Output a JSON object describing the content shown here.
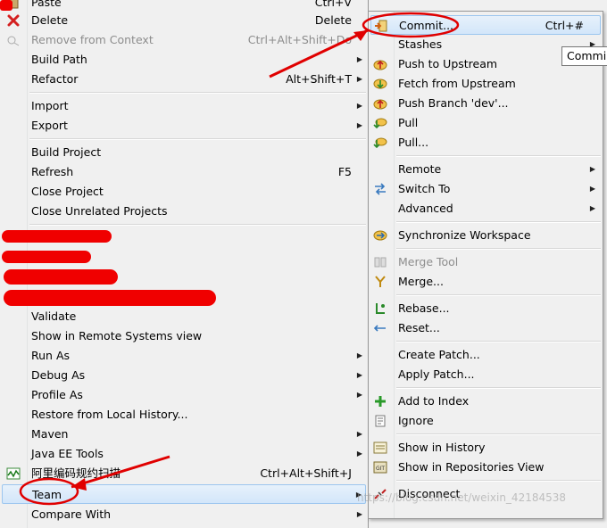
{
  "left_menu": {
    "paste": {
      "label": "Paste",
      "shortcut": "Ctrl+V"
    },
    "delete": {
      "label": "Delete",
      "shortcut": "Delete",
      "icon": "red-x-icon"
    },
    "remove_from_context": {
      "label": "Remove from Context",
      "shortcut": "Ctrl+Alt+Shift+Do"
    },
    "build_path": {
      "label": "Build Path"
    },
    "refactor": {
      "label": "Refactor",
      "shortcut": "Alt+Shift+T"
    },
    "import": {
      "label": "Import"
    },
    "export": {
      "label": "Export"
    },
    "build_project": {
      "label": "Build Project"
    },
    "refresh": {
      "label": "Refresh",
      "shortcut": "F5"
    },
    "close_project": {
      "label": "Close Project"
    },
    "close_unrelated": {
      "label": "Close Unrelated Projects"
    },
    "validate": {
      "label": "Validate"
    },
    "show_remote": {
      "label": "Show in Remote Systems view"
    },
    "run_as": {
      "label": "Run As"
    },
    "debug_as": {
      "label": "Debug As"
    },
    "profile_as": {
      "label": "Profile As"
    },
    "restore_history": {
      "label": "Restore from Local History..."
    },
    "maven": {
      "label": "Maven"
    },
    "java_ee_tools": {
      "label": "Java EE Tools"
    },
    "alibaba": {
      "label": "阿里编码规约扫描",
      "shortcut": "Ctrl+Alt+Shift+J"
    },
    "team": {
      "label": "Team"
    },
    "compare_with": {
      "label": "Compare With"
    }
  },
  "right_menu": {
    "commit": {
      "label": "Commit...",
      "shortcut": "Ctrl+#"
    },
    "stashes": {
      "label": "Stashes"
    },
    "push_upstream": {
      "label": "Push to Upstream"
    },
    "fetch_upstream": {
      "label": "Fetch from Upstream"
    },
    "push_branch": {
      "label": "Push Branch 'dev'..."
    },
    "pull": {
      "label": "Pull"
    },
    "pull_dialog": {
      "label": "Pull..."
    },
    "remote": {
      "label": "Remote"
    },
    "switch_to": {
      "label": "Switch To"
    },
    "advanced": {
      "label": "Advanced"
    },
    "synchronize": {
      "label": "Synchronize Workspace"
    },
    "merge_tool": {
      "label": "Merge Tool"
    },
    "merge": {
      "label": "Merge..."
    },
    "rebase": {
      "label": "Rebase..."
    },
    "reset": {
      "label": "Reset..."
    },
    "create_patch": {
      "label": "Create Patch..."
    },
    "apply_patch": {
      "label": "Apply Patch..."
    },
    "add_index": {
      "label": "Add to Index"
    },
    "ignore": {
      "label": "Ignore"
    },
    "show_history": {
      "label": "Show in History"
    },
    "show_repos": {
      "label": "Show in Repositories View"
    },
    "disconnect": {
      "label": "Disconnect"
    }
  },
  "tooltip": {
    "text": "Commi"
  },
  "watermark": {
    "text": "https://blog.csdn.net/weixin_42184538"
  },
  "colors": {
    "annotation": "#e00000",
    "highlight": "#d3e6fa",
    "menu_bg": "#f0f0f0"
  }
}
